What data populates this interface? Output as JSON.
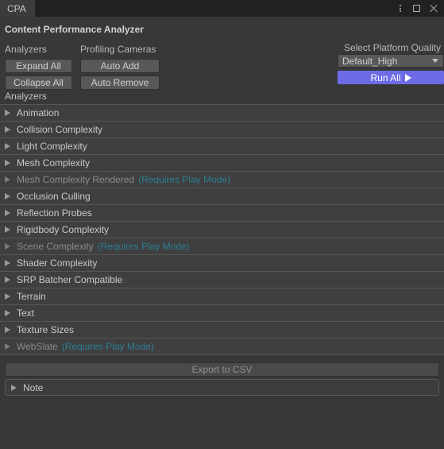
{
  "window": {
    "tab_label": "CPA",
    "controls": [
      {
        "name": "kebab-menu-icon",
        "label": "⋮"
      },
      {
        "name": "maximize-icon",
        "label": "□"
      },
      {
        "name": "close-icon",
        "label": "✕"
      }
    ]
  },
  "header": {
    "title": "Content Performance Analyzer"
  },
  "toolbar": {
    "analyzers_label": "Analyzers",
    "cameras_label": "Profiling Cameras",
    "expand_all": "Expand All",
    "collapse_all": "Collapse All",
    "auto_add": "Auto Add",
    "auto_remove": "Auto Remove",
    "quality_label": "Select Platform Quality",
    "quality_value": "Default_High",
    "quality_options": [
      "Default_High"
    ],
    "run_all": "Run All",
    "run_all_icon": "play-triangle",
    "accent_color": "#6d6ce6"
  },
  "list": {
    "section_label": "Analyzers",
    "play_mode_hint": "(Requires Play Mode)",
    "hint_color": "#2d7d93",
    "items": [
      {
        "label": "Animation",
        "disabled": false,
        "hint": ""
      },
      {
        "label": "Collision Complexity",
        "disabled": false,
        "hint": ""
      },
      {
        "label": "Light Complexity",
        "disabled": false,
        "hint": ""
      },
      {
        "label": "Mesh Complexity",
        "disabled": false,
        "hint": ""
      },
      {
        "label": "Mesh Complexity Rendered",
        "disabled": true,
        "hint": "(Requires Play Mode)"
      },
      {
        "label": "Occlusion Culling",
        "disabled": false,
        "hint": ""
      },
      {
        "label": "Reflection Probes",
        "disabled": false,
        "hint": ""
      },
      {
        "label": "Rigidbody Complexity",
        "disabled": false,
        "hint": ""
      },
      {
        "label": "Scene Complexity",
        "disabled": true,
        "hint": "(Requires Play Mode)"
      },
      {
        "label": "Shader Complexity",
        "disabled": false,
        "hint": ""
      },
      {
        "label": "SRP Batcher Compatible",
        "disabled": false,
        "hint": ""
      },
      {
        "label": "Terrain",
        "disabled": false,
        "hint": ""
      },
      {
        "label": "Text",
        "disabled": false,
        "hint": ""
      },
      {
        "label": "Texture Sizes",
        "disabled": false,
        "hint": ""
      },
      {
        "label": "WebSlate",
        "disabled": true,
        "hint": "(Requires Play Mode)"
      }
    ]
  },
  "footer": {
    "export_label": "Export to CSV",
    "note_label": "Note"
  }
}
